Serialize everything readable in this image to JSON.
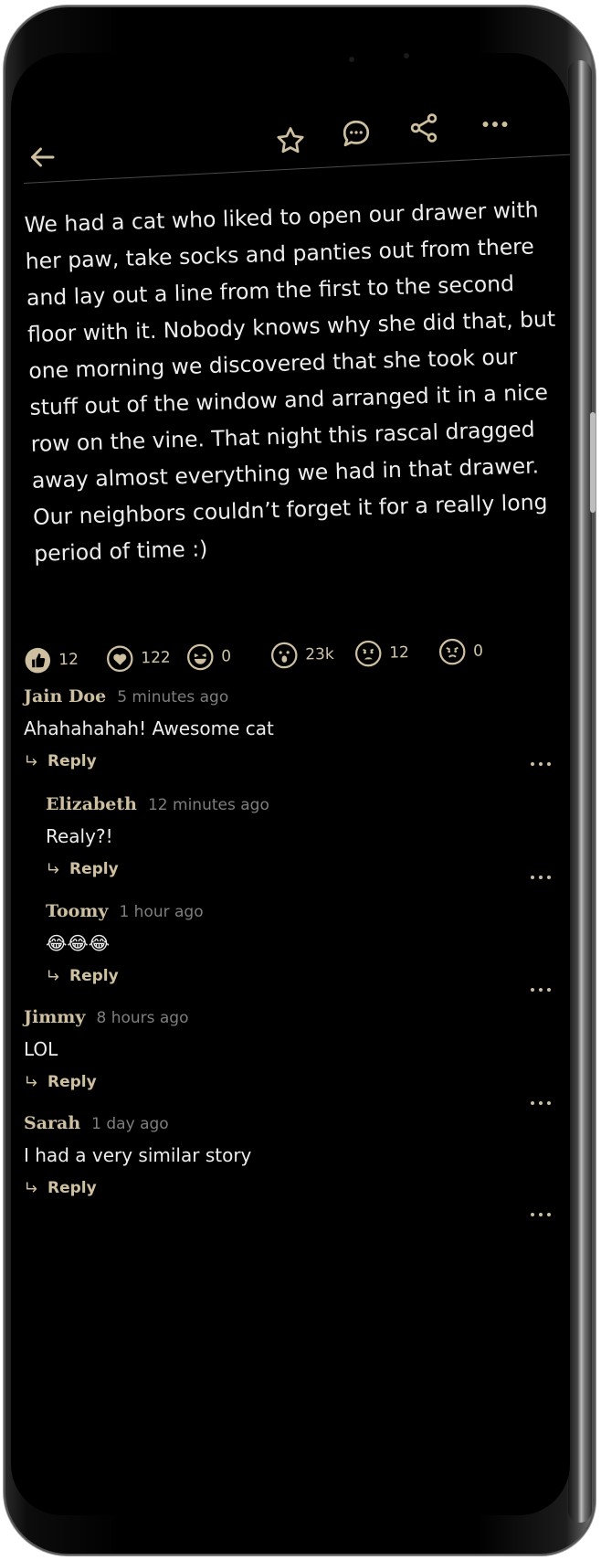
{
  "header": {
    "back_icon": "arrow-left-icon",
    "actions": [
      {
        "name": "star-icon"
      },
      {
        "name": "comment-icon"
      },
      {
        "name": "share-icon"
      },
      {
        "name": "more-icon"
      }
    ]
  },
  "post": {
    "text": "We had a cat who liked to open our drawer with her paw, take socks and panties out from there and lay out a line from the first to the second floor with it. Nobody knows why she did that, but one morning we discovered that she took our stuff out of the window and arranged it in a nice row on the vine. That night this rascal dragged away almost everything we had in that drawer. Our neighbors couldn’t forget it for a really long period of time :)"
  },
  "reactions": [
    {
      "icon": "thumbs-up-icon",
      "count": "12"
    },
    {
      "icon": "heart-icon",
      "count": "122"
    },
    {
      "icon": "laugh-icon",
      "count": "0"
    },
    {
      "icon": "wow-icon",
      "count": "23k"
    },
    {
      "icon": "sad-icon",
      "count": "12"
    },
    {
      "icon": "angry-icon",
      "count": "0"
    }
  ],
  "reply_label": "Reply",
  "comments": [
    {
      "author": "Jain Doe",
      "time": "5 minutes ago",
      "body": "Ahahahahah! Awesome cat"
    },
    {
      "author": "Elizabeth",
      "time": "12 minutes ago",
      "body": "Realy?!"
    },
    {
      "author": "Toomy",
      "time": "1 hour ago",
      "body": "😂😂😂"
    },
    {
      "author": "Jimmy",
      "time": "8 hours ago",
      "body": "LOL"
    },
    {
      "author": "Sarah",
      "time": "1 day ago",
      "body": "I had a very similar story"
    }
  ],
  "colors": {
    "accent": "#cdbf9f",
    "background": "#000000",
    "text": "#ededed",
    "muted": "#7e7e7e"
  }
}
